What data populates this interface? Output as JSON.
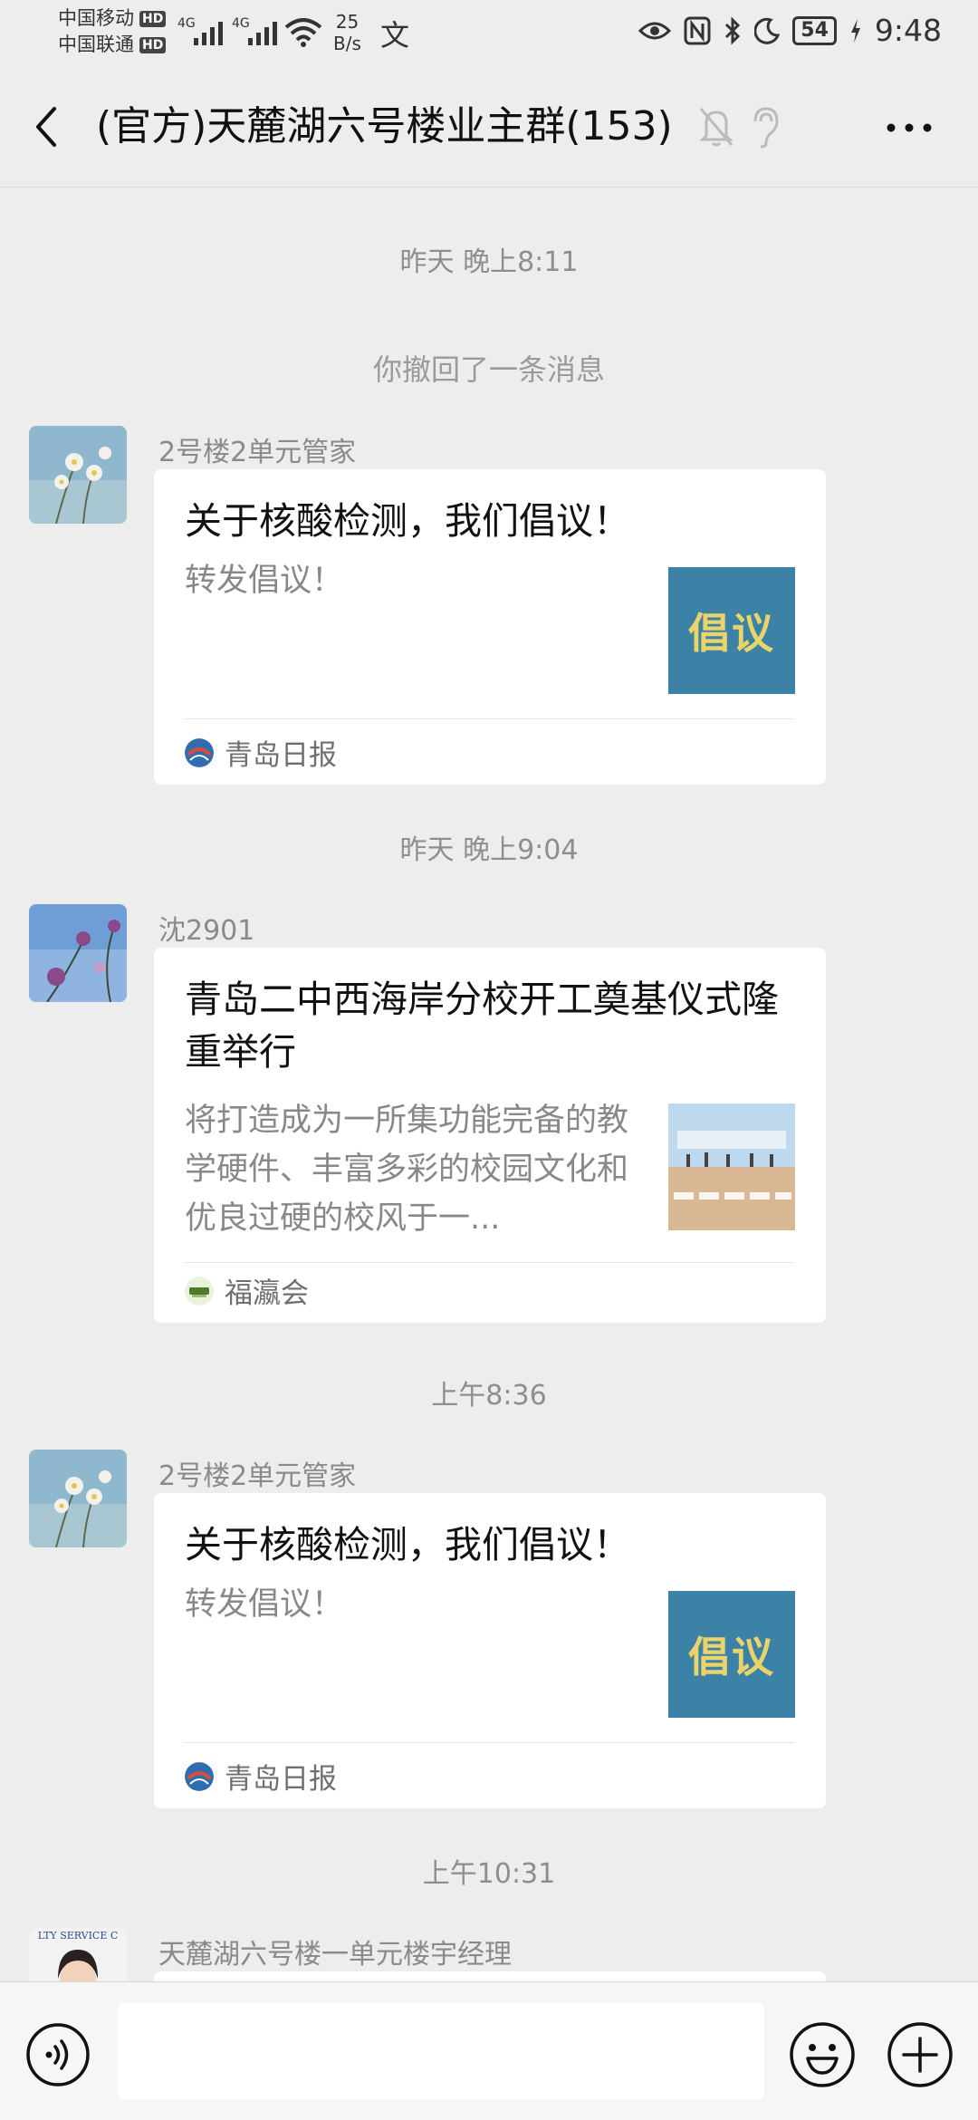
{
  "status_bar": {
    "carrier_1": "中国移动",
    "carrier_2": "中国联通",
    "hd_1": "HD",
    "hd_2": "HD",
    "signal_1_tag": "4G",
    "signal_2_tag": "4G",
    "net_speed_value": "25",
    "net_speed_unit": "B/s",
    "extra_icon": "文",
    "battery": "54",
    "time": "9:48"
  },
  "header": {
    "title": "(官方)天麓湖六号楼业主群(153)"
  },
  "chat": {
    "timestamps": [
      "昨天 晚上8:11",
      "昨天 晚上9:04",
      "上午8:36",
      "上午10:31"
    ],
    "system_message": "你撤回了一条消息",
    "messages": [
      {
        "sender": "2号楼2单元管家",
        "title": "关于核酸检测，我们倡议！",
        "desc": "转发倡议！",
        "thumb_text": "倡议",
        "source": "青岛日报"
      },
      {
        "sender": "沈2901",
        "title": "青岛二中西海岸分校开工奠基仪式隆重举行",
        "desc": "将打造成为一所集功能完备的教学硬件、丰富多彩的校园文化和优良过硬的校风于一...",
        "source": "福瀛会"
      },
      {
        "sender": "2号楼2单元管家",
        "title": "关于核酸检测，我们倡议！",
        "desc": "转发倡议！",
        "thumb_text": "倡议",
        "source": "青岛日报"
      },
      {
        "sender": "天麓湖六号楼一单元楼宇经理",
        "avatar_text": "LTY SERVICE C"
      }
    ]
  },
  "colors": {
    "background": "#ededed",
    "card": "#ffffff",
    "thumb_bg": "#3b82a6",
    "thumb_text": "#e9d36a",
    "muted_text": "#8e8e8e"
  }
}
